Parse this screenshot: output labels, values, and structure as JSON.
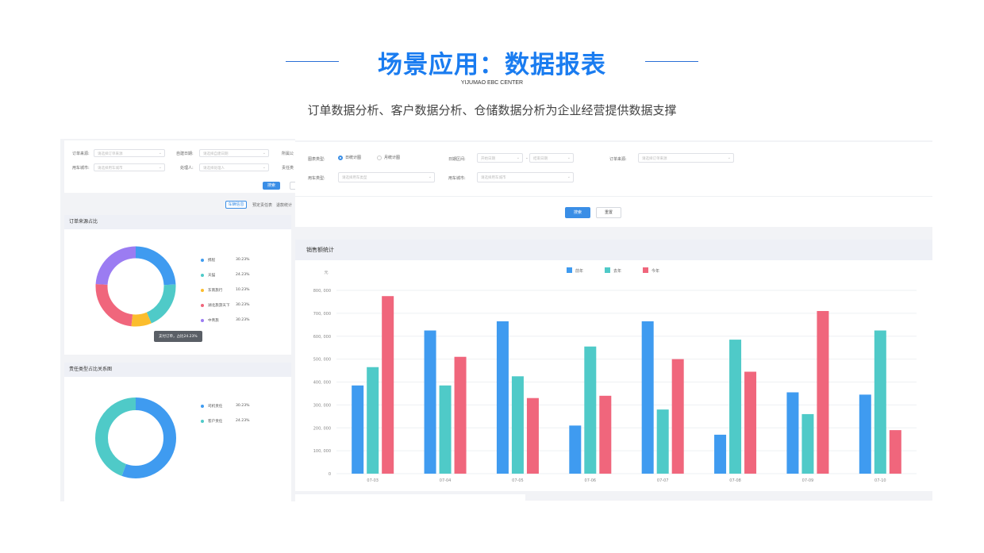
{
  "hero": {
    "title": "场景应用：数据报表",
    "subtitle": "YIJUMAO EBC CENTER",
    "description": "订单数据分析、客户数据分析、仓储数据分析为企业经营提供数据支撑"
  },
  "left_filter": {
    "row1": [
      {
        "label": "订单来源:",
        "placeholder": "请选择订单来源"
      },
      {
        "label": "自建日期:",
        "placeholder": "请选择自建日期"
      },
      {
        "label": "所属公"
      }
    ],
    "row2": [
      {
        "label": "用车城市:",
        "placeholder": "请选择用车城市"
      },
      {
        "label": "处理人:",
        "placeholder": "请选择处理人"
      },
      {
        "label": "责任类"
      }
    ],
    "search_label": "搜索"
  },
  "left_tabs": [
    "车辆信息",
    "预定责任表",
    "退款统计"
  ],
  "order_source": {
    "title": "订单来源占比",
    "legend": [
      {
        "name": "携程",
        "value": "30.23%",
        "color": "#3f9bf0"
      },
      {
        "name": "天猫",
        "value": "24.23%",
        "color": "#4fcac8"
      },
      {
        "name": "东南旅行",
        "value": "10.23%",
        "color": "#fbbd2d"
      },
      {
        "name": "湖北旅游天下",
        "value": "30.23%",
        "color": "#f0667c"
      },
      {
        "name": "中青旅",
        "value": "30.23%",
        "color": "#9b7cf2"
      }
    ],
    "tooltip": "支付订单，占比24.23%"
  },
  "responsibility": {
    "title": "责任类型占比关系图",
    "legend": [
      {
        "name": "司机责任",
        "value": "30.23%",
        "color": "#3f9bf0"
      },
      {
        "name": "客户责任",
        "value": "24.23%",
        "color": "#4fcac8"
      }
    ]
  },
  "right_filter": {
    "chart_type_label": "图表类型:",
    "radio_day": "日统计图",
    "radio_month": "月统计图",
    "date_range_label": "日期区间:",
    "start_placeholder": "开始日期",
    "range_sep": "-",
    "end_placeholder": "结束日期",
    "order_source_label": "订单来源:",
    "order_source_placeholder": "请选择订单来源",
    "car_type_label": "用车类型:",
    "car_type_placeholder": "请选择用车类型",
    "car_city_label": "用车城市:",
    "car_city_placeholder": "请选择用车城市",
    "search_label": "搜索",
    "reset_label": "重置"
  },
  "chart_data": {
    "type": "bar",
    "title": "销售额统计",
    "ylabel": "元",
    "categories": [
      "07-03",
      "07-04",
      "07-05",
      "07-06",
      "07-07",
      "07-08",
      "07-09",
      "07-10"
    ],
    "ylim": [
      0,
      800000
    ],
    "yticks": [
      "0",
      "100, 000",
      "200, 000",
      "300, 000",
      "400, 000",
      "500, 000",
      "600, 000",
      "700, 000",
      "800, 000"
    ],
    "series": [
      {
        "name": "前年",
        "color": "#3f9bf0",
        "values": [
          385000,
          625000,
          665000,
          210000,
          665000,
          170000,
          355000,
          345000
        ]
      },
      {
        "name": "去年",
        "color": "#4fcac8",
        "values": [
          465000,
          385000,
          425000,
          555000,
          280000,
          585000,
          260000,
          625000
        ]
      },
      {
        "name": "今年",
        "color": "#f0667c",
        "values": [
          775000,
          510000,
          330000,
          340000,
          500000,
          445000,
          710000,
          190000
        ]
      }
    ],
    "legend_position": "top-center",
    "grid": true
  }
}
